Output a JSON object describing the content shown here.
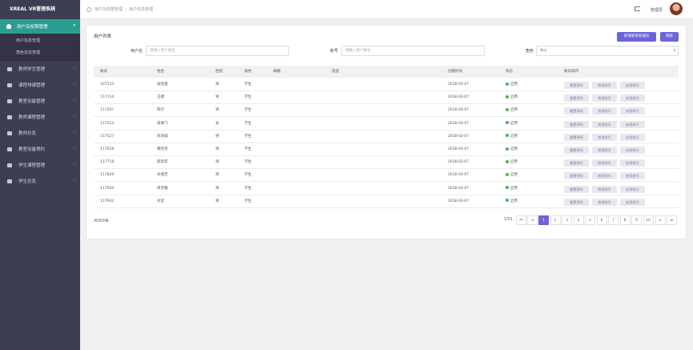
{
  "app_title": "XREAL VR管理系统",
  "sidebar": {
    "active_label": "用户及权限管理",
    "submenu": [
      "用户信息管理",
      "角色信息管理"
    ],
    "items": [
      "教师学生管理",
      "课程排课管理",
      "教室设备管理",
      "教师课程管理",
      "教师总览",
      "教室设备预约",
      "学生课程管理",
      "学生总览"
    ]
  },
  "breadcrumb": [
    "用户及权限管理",
    "用户信息管理"
  ],
  "header": {
    "admin_label": "管理员"
  },
  "main": {
    "title": "用户列表",
    "btn_new": "新增教育管理员",
    "btn_search": "搜索",
    "filters": {
      "username_label": "用户名",
      "username_placeholder": "请输入用户姓名",
      "account_label": "账号",
      "account_placeholder": "请输入用户账号",
      "role_label": "角色",
      "role_value": "ALL"
    },
    "columns": [
      "账号",
      "姓名",
      "性别",
      "角色",
      "邮箱",
      "电话",
      "创建时间",
      "状态",
      "账号操作"
    ],
    "rows": [
      {
        "account": "107523",
        "name": "候佳俊",
        "gender": "男",
        "role": "学生",
        "email": "",
        "phone": "",
        "created": "2018-02-07",
        "status": "启用"
      },
      {
        "account": "117114",
        "name": "王捷",
        "gender": "男",
        "role": "学生",
        "email": "",
        "phone": "",
        "created": "2018-02-07",
        "status": "启用"
      },
      {
        "account": "117207",
        "name": "陈行",
        "gender": "男",
        "role": "学生",
        "email": "",
        "phone": "",
        "created": "2018-02-07",
        "status": "启用"
      },
      {
        "account": "117514",
        "name": "朱琳飞",
        "gender": "女",
        "role": "学生",
        "email": "",
        "phone": "",
        "created": "2018-02-07",
        "status": "启用"
      },
      {
        "account": "117527",
        "name": "何浩威",
        "gender": "男",
        "role": "学生",
        "email": "",
        "phone": "",
        "created": "2018-02-07",
        "status": "启用"
      },
      {
        "account": "117618",
        "name": "魏佳尧",
        "gender": "男",
        "role": "学生",
        "email": "",
        "phone": "",
        "created": "2018-02-07",
        "status": "启用"
      },
      {
        "account": "117718",
        "name": "薛思宏",
        "gender": "男",
        "role": "学生",
        "email": "",
        "phone": "",
        "created": "2018-02-07",
        "status": "启用"
      },
      {
        "account": "117829",
        "name": "亦瑾芝",
        "gender": "男",
        "role": "学生",
        "email": "",
        "phone": "",
        "created": "2018-02-07",
        "status": "启用"
      },
      {
        "account": "117920",
        "name": "周罗雅",
        "gender": "男",
        "role": "学生",
        "email": "",
        "phone": "",
        "created": "2018-02-07",
        "status": "启用"
      },
      {
        "account": "117932",
        "name": "孙莹",
        "gender": "男",
        "role": "学生",
        "email": "",
        "phone": "",
        "created": "2018-02-07",
        "status": "启用"
      }
    ],
    "row_actions": [
      "重置密码",
      "禁用账号",
      "启用账号"
    ],
    "total": "共303条",
    "pager_info": "1/31",
    "pages": [
      "1",
      "2",
      "3",
      "4",
      "5",
      "6",
      "7",
      "8",
      "9",
      "10"
    ],
    "active_page": "1"
  }
}
